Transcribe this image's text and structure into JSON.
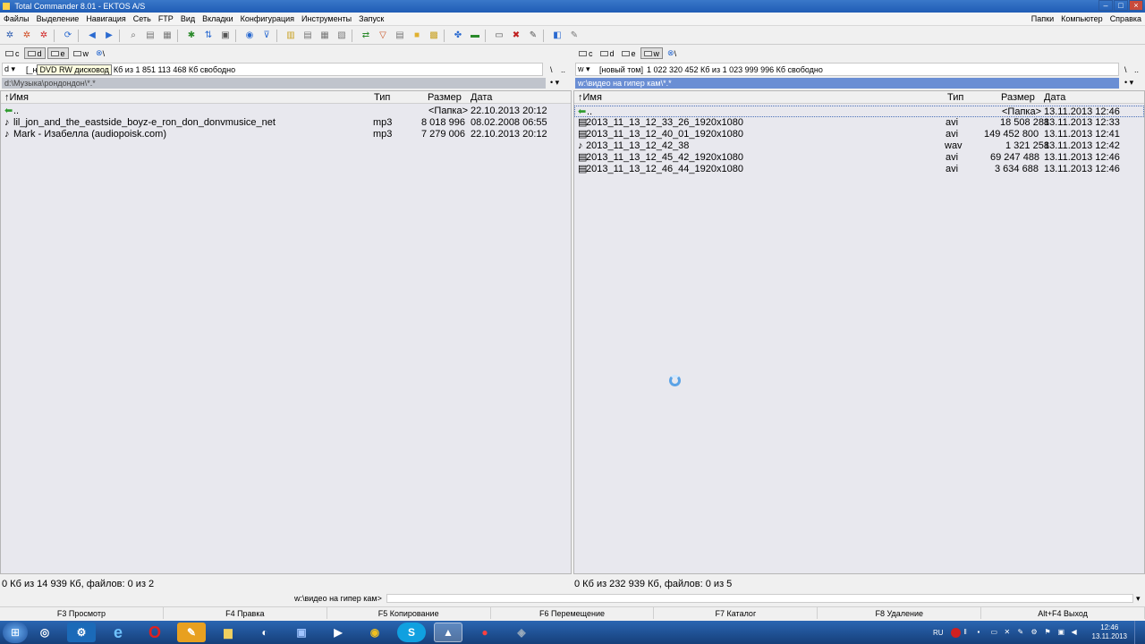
{
  "window": {
    "title": "Total Commander 8.01 - EKTOS A/S"
  },
  "menu": {
    "left": [
      "Файлы",
      "Выделение",
      "Навигация",
      "Сеть",
      "FTP",
      "Вид",
      "Вкладки",
      "Конфигурация",
      "Инструменты",
      "Запуск"
    ],
    "right": [
      "Папки",
      "Компьютер",
      "Справка"
    ]
  },
  "left_panel": {
    "drives": [
      "c",
      "d",
      "e",
      "w",
      "\\"
    ],
    "active_drive": "d",
    "drive_select": "d",
    "tooltip": "DVD RW дисковод",
    "drive_label": "[_н",
    "free_space": "Кб из 1 851 113 468 Кб свободно",
    "path": "d:\\Музыка\\рондондон\\*.*",
    "nav": [
      "\\",
      ".."
    ],
    "columns": {
      "name": "Имя",
      "type": "Тип",
      "size": "Размер",
      "date": "Дата"
    },
    "up_row": {
      "name": "..",
      "size": "<Папка>",
      "date": "22.10.2013 20:12"
    },
    "files": [
      {
        "name": "lil_jon_and_the_eastside_boyz-e_ron_don_donvmusice_net",
        "type": "mp3",
        "size": "8 018 996",
        "date": "08.02.2008 06:55"
      },
      {
        "name": "Mark - Изабелла (audiopoisk.com)",
        "type": "mp3",
        "size": "7 279 006",
        "date": "22.10.2013 20:12"
      }
    ],
    "status": "0 Кб из 14 939 Кб, файлов: 0 из 2"
  },
  "right_panel": {
    "drives": [
      "c",
      "d",
      "e",
      "w",
      "\\"
    ],
    "active_drive": "w",
    "drive_select": "w",
    "drive_label": "[новый том]",
    "free_space": "1 022 320 452 Кб из 1 023 999 996 Кб свободно",
    "path": "w:\\видео на гипер кам\\*.*",
    "nav": [
      "\\",
      ".."
    ],
    "columns": {
      "name": "Имя",
      "type": "Тип",
      "size": "Размер",
      "date": "Дата"
    },
    "up_row": {
      "name": "..",
      "size": "<Папка>",
      "date": "13.11.2013 12:46"
    },
    "files": [
      {
        "name": "2013_11_13_12_33_26_1920x1080",
        "type": "avi",
        "size": "18 508 288",
        "date": "13.11.2013 12:33"
      },
      {
        "name": "2013_11_13_12_40_01_1920x1080",
        "type": "avi",
        "size": "149 452 800",
        "date": "13.11.2013 12:41"
      },
      {
        "name": "2013_11_13_12_42_38",
        "type": "wav",
        "size": "1 321 258",
        "date": "13.11.2013 12:42"
      },
      {
        "name": "2013_11_13_12_45_42_1920x1080",
        "type": "avi",
        "size": "69 247 488",
        "date": "13.11.2013 12:46"
      },
      {
        "name": "2013_11_13_12_46_44_1920x1080",
        "type": "avi",
        "size": "3 634 688",
        "date": "13.11.2013 12:46"
      }
    ],
    "status": "0 Кб из 232 939 Кб, файлов: 0 из 5"
  },
  "command_line": {
    "path": "w:\\видео на гипер кам>"
  },
  "fkeys": [
    "F3 Просмотр",
    "F4 Правка",
    "F5 Копирование",
    "F6 Перемещение",
    "F7 Каталог",
    "F8 Удаление",
    "Alt+F4 Выход"
  ],
  "taskbar": {
    "apps": [
      "windows-start",
      "network",
      "steam",
      "internet-explorer",
      "opera",
      "total-commander",
      "explorer-folder",
      "media-app",
      "floppy-save",
      "video-app",
      "chrome",
      "skype",
      "world-of-tanks",
      "recorder",
      "virtualbox"
    ],
    "lang": "RU",
    "time": "12:46",
    "date": "13.11.2013"
  },
  "colors": {
    "active_path": "#6a8ed4",
    "panel_bg": "#e8e8ee",
    "taskbar": "#1f4f94"
  }
}
